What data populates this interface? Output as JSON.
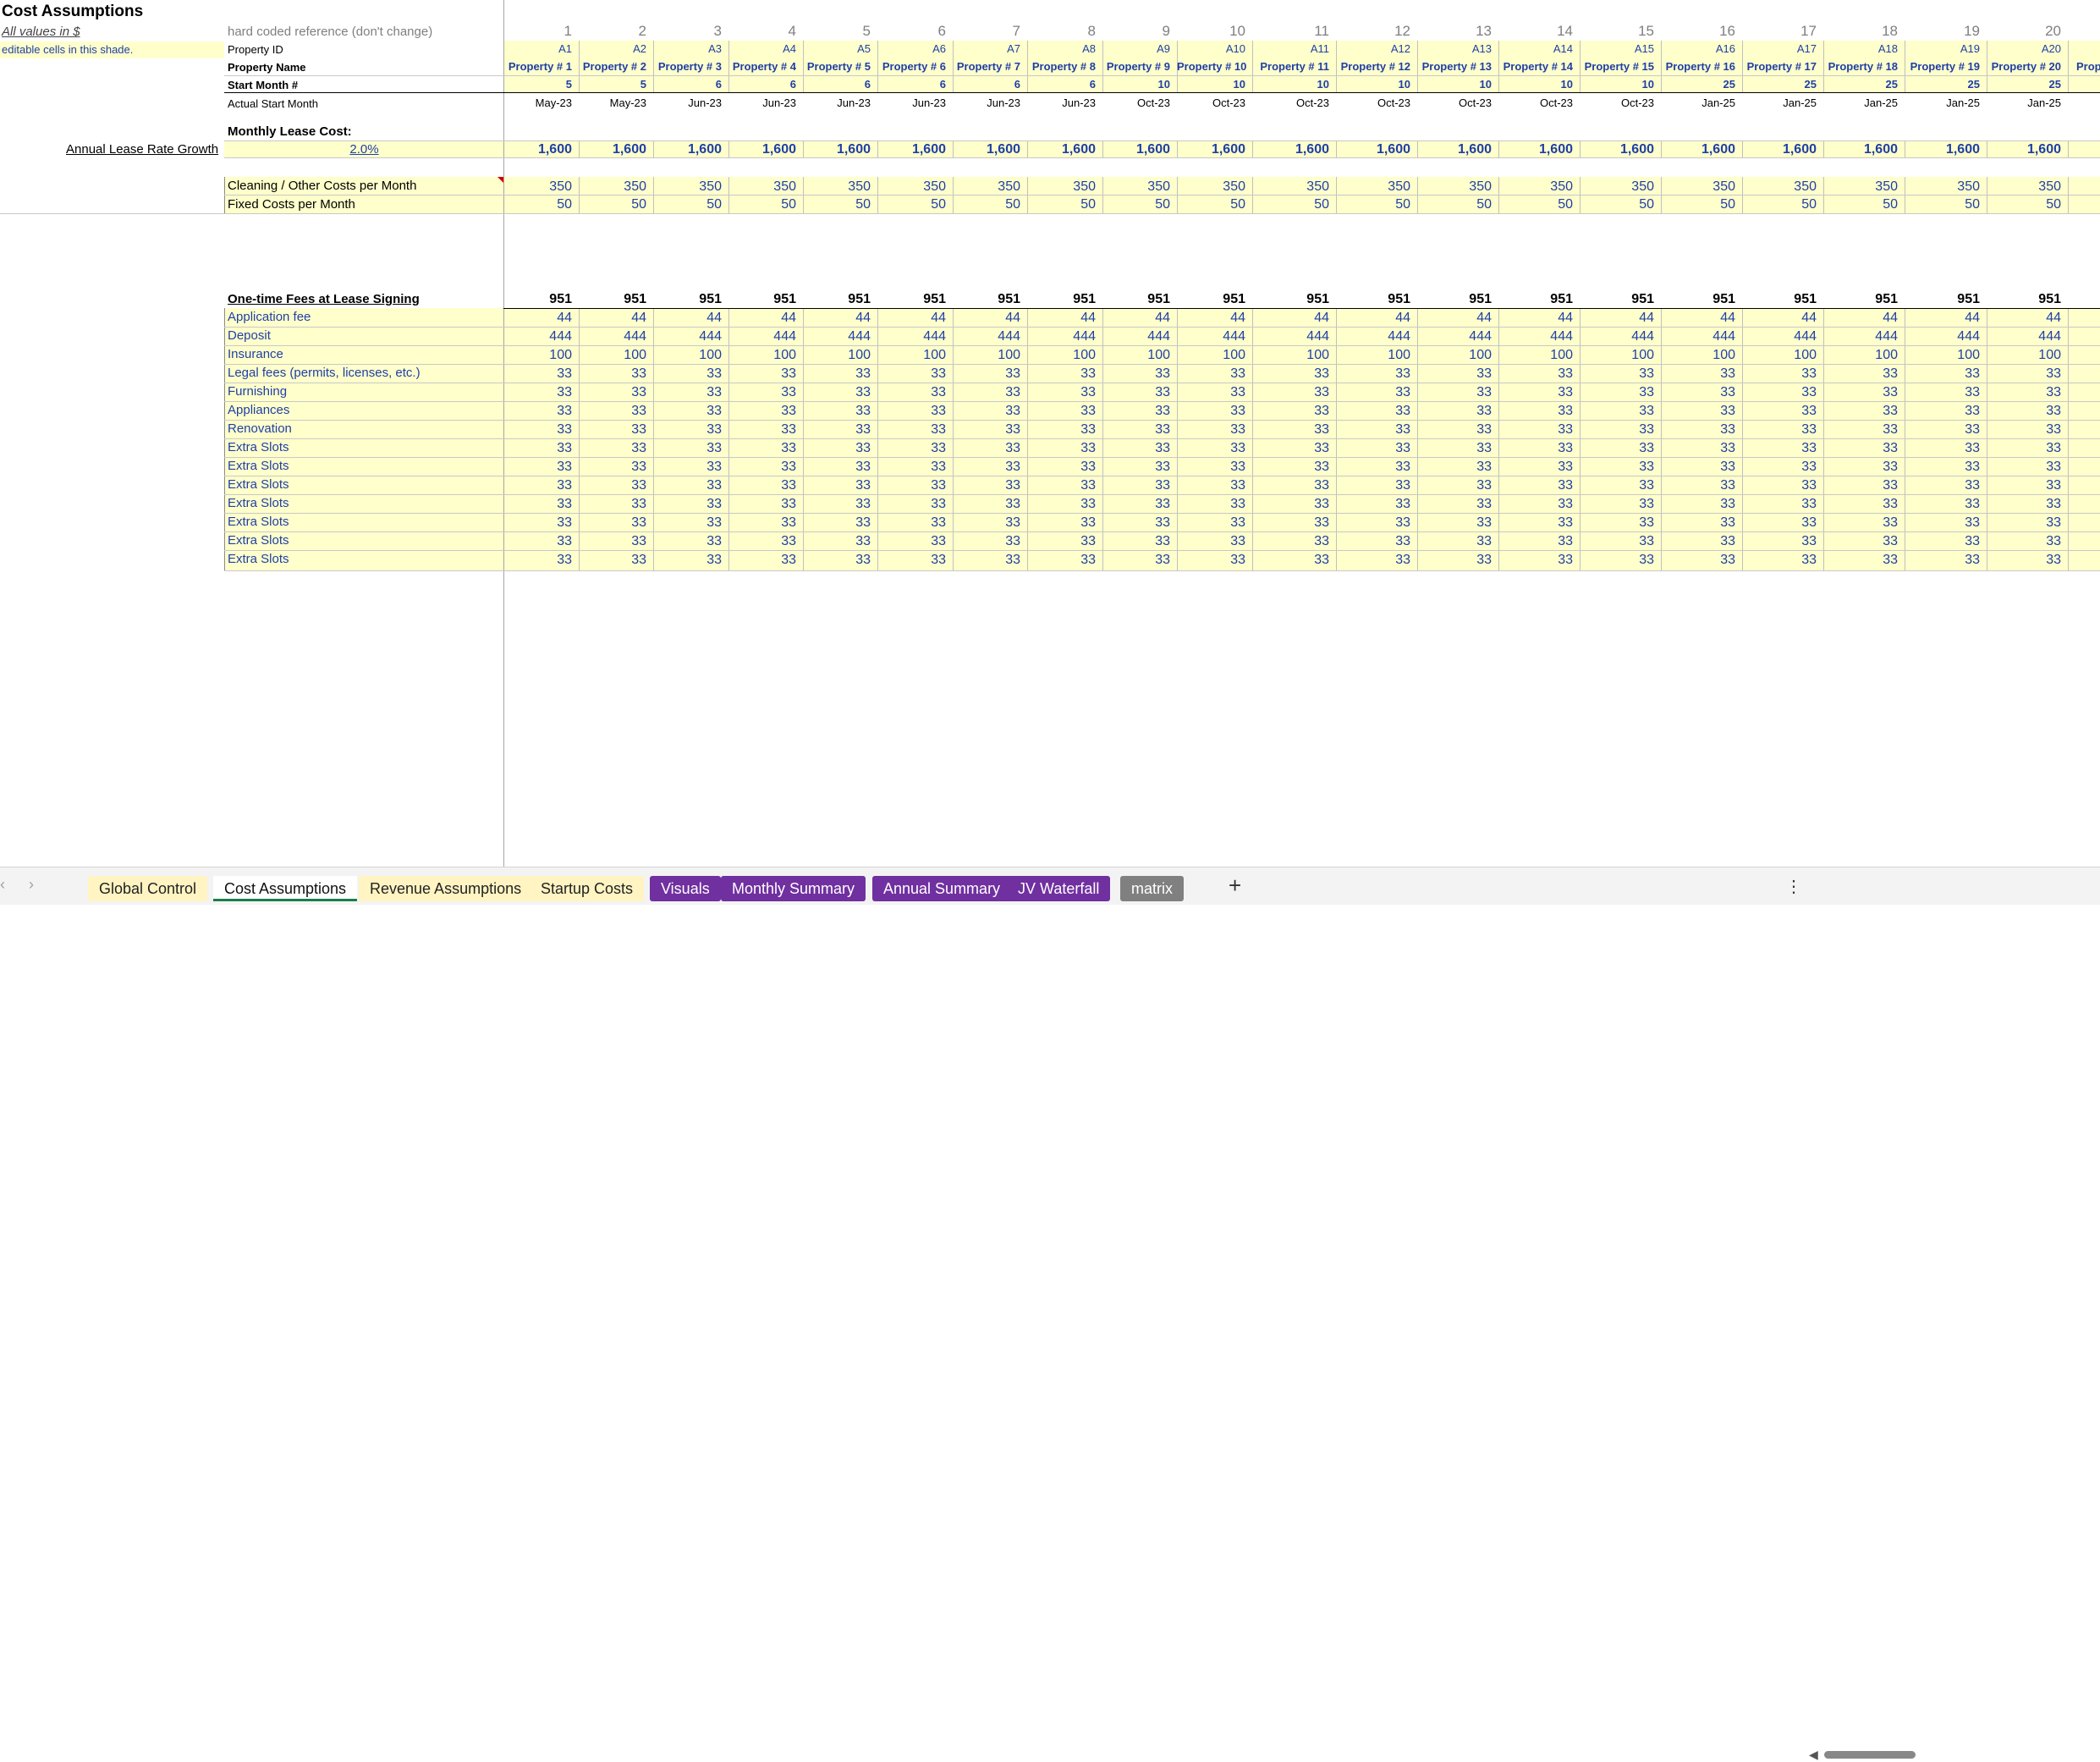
{
  "sheet": {
    "title": "Cost Assumptions",
    "all_values": "All values in $",
    "editable_note": "editable cells in this shade.",
    "hardcoded_ref": "hard coded reference (don't change)",
    "row_labels": {
      "property_id": "Property ID",
      "property_name": "Property Name",
      "start_month": "Start Month #",
      "actual_start": "Actual Start Month",
      "monthly_lease": "Monthly Lease Cost:",
      "annual_growth": "Annual Lease Rate Growth",
      "annual_growth_value": "2.0%",
      "cleaning": "Cleaning / Other Costs per Month",
      "fixed": "Fixed Costs per Month",
      "one_time": "One-time Fees at Lease Signing"
    },
    "columns": {
      "index": [
        "1",
        "2",
        "3",
        "4",
        "5",
        "6",
        "7",
        "8",
        "9",
        "10",
        "11",
        "12",
        "13",
        "14",
        "15",
        "16",
        "17",
        "18",
        "19",
        "20"
      ],
      "ids": [
        "A1",
        "A2",
        "A3",
        "A4",
        "A5",
        "A6",
        "A7",
        "A8",
        "A9",
        "A10",
        "A11",
        "A12",
        "A13",
        "A14",
        "A15",
        "A16",
        "A17",
        "A18",
        "A19",
        "A20"
      ],
      "names": [
        "Property # 1",
        "Property # 2",
        "Property # 3",
        "Property # 4",
        "Property # 5",
        "Property # 6",
        "Property # 7",
        "Property # 8",
        "Property # 9",
        "Property # 10",
        "Property # 11",
        "Property # 12",
        "Property # 13",
        "Property # 14",
        "Property # 15",
        "Property # 16",
        "Property # 17",
        "Property # 18",
        "Property # 19",
        "Property # 20"
      ],
      "start_month": [
        "5",
        "5",
        "6",
        "6",
        "6",
        "6",
        "6",
        "6",
        "10",
        "10",
        "10",
        "10",
        "10",
        "10",
        "10",
        "25",
        "25",
        "25",
        "25",
        "25"
      ],
      "actual_start": [
        "May-23",
        "May-23",
        "Jun-23",
        "Jun-23",
        "Jun-23",
        "Jun-23",
        "Jun-23",
        "Jun-23",
        "Oct-23",
        "Oct-23",
        "Oct-23",
        "Oct-23",
        "Oct-23",
        "Oct-23",
        "Oct-23",
        "Jan-25",
        "Jan-25",
        "Jan-25",
        "Jan-25",
        "Jan-25"
      ],
      "lease": [
        "1,600",
        "1,600",
        "1,600",
        "1,600",
        "1,600",
        "1,600",
        "1,600",
        "1,600",
        "1,600",
        "1,600",
        "1,600",
        "1,600",
        "1,600",
        "1,600",
        "1,600",
        "1,600",
        "1,600",
        "1,600",
        "1,600",
        "1,600"
      ],
      "cleaning": [
        "350",
        "350",
        "350",
        "350",
        "350",
        "350",
        "350",
        "350",
        "350",
        "350",
        "350",
        "350",
        "350",
        "350",
        "350",
        "350",
        "350",
        "350",
        "350",
        "350"
      ],
      "fixed": [
        "50",
        "50",
        "50",
        "50",
        "50",
        "50",
        "50",
        "50",
        "50",
        "50",
        "50",
        "50",
        "50",
        "50",
        "50",
        "50",
        "50",
        "50",
        "50",
        "50"
      ],
      "one_time_total": [
        "951",
        "951",
        "951",
        "951",
        "951",
        "951",
        "951",
        "951",
        "951",
        "951",
        "951",
        "951",
        "951",
        "951",
        "951",
        "951",
        "951",
        "951",
        "951",
        "951"
      ],
      "partial_next_name": "Propi"
    },
    "fees": [
      {
        "label": "Application fee",
        "value": "44"
      },
      {
        "label": "Deposit",
        "value": "444"
      },
      {
        "label": "Insurance",
        "value": "100"
      },
      {
        "label": "Legal fees (permits, licenses, etc.)",
        "value": "33"
      },
      {
        "label": "Furnishing",
        "value": "33"
      },
      {
        "label": "Appliances",
        "value": "33"
      },
      {
        "label": "Renovation",
        "value": "33"
      },
      {
        "label": "Extra Slots",
        "value": "33"
      },
      {
        "label": "Extra Slots",
        "value": "33"
      },
      {
        "label": "Extra Slots",
        "value": "33"
      },
      {
        "label": "Extra Slots",
        "value": "33"
      },
      {
        "label": "Extra Slots",
        "value": "33"
      },
      {
        "label": "Extra Slots",
        "value": "33"
      },
      {
        "label": "Extra Slots",
        "value": "33"
      }
    ]
  },
  "tabs": {
    "prev": "‹",
    "next": "›",
    "items": [
      {
        "label": "Global Control",
        "style": "yellowtab"
      },
      {
        "label": "Cost Assumptions",
        "style": "active"
      },
      {
        "label": "Revenue Assumptions",
        "style": "yellowtab"
      },
      {
        "label": "Startup Costs",
        "style": "yellowtab"
      },
      {
        "label": "Visuals",
        "style": "purple"
      },
      {
        "label": "Monthly Summary",
        "style": "purple"
      },
      {
        "label": "Annual Summary",
        "style": "purple"
      },
      {
        "label": "JV Waterfall",
        "style": "purple"
      },
      {
        "label": "matrix",
        "style": "gray"
      }
    ],
    "add": "+",
    "more": "⋮"
  },
  "colors": {
    "editable": "#ffffcc",
    "blue_text": "#1f3fa6",
    "purple_tab": "#7030a0"
  }
}
